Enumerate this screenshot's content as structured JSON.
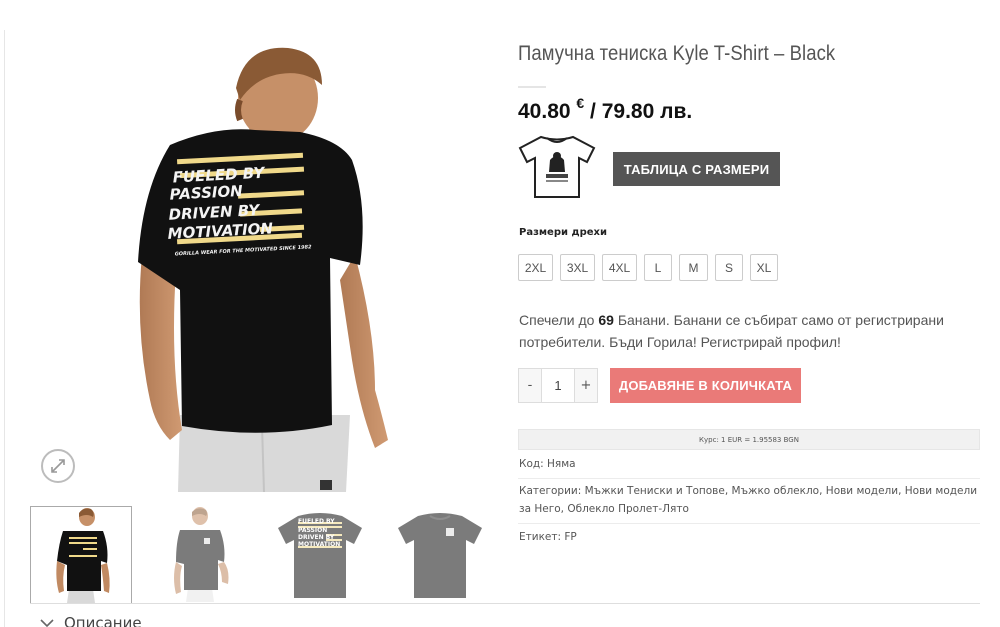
{
  "product": {
    "title": "Памучна тениска Kyle T-Shirt – Black",
    "price_eur": "40.80",
    "currency_eur": "€",
    "price_separator": "/",
    "price_bgn": "79.80 лв."
  },
  "size_chart_button": "ТАБЛИЦА С РАЗМЕРИ",
  "sizes_label": "Размери дрехи",
  "sizes": [
    "2XL",
    "3XL",
    "4XL",
    "L",
    "M",
    "S",
    "XL"
  ],
  "bananas": {
    "prefix": "Спечели до",
    "count": "69",
    "suffix": "Банани. Банани се събират само от регистрирани потребители. Бъди Горила! Регистрирай профил!"
  },
  "quantity": {
    "minus": "-",
    "value": "1",
    "plus": "+"
  },
  "add_to_cart": "ДОБАВЯНЕ В КОЛИЧКАТА",
  "exchange_rate": "Курс: 1 EUR = 1.95583 BGN",
  "meta": {
    "sku_label": "Код:",
    "sku_value": "Няма",
    "categories_label": "Категории:",
    "categories": [
      "Мъжки Тениски и Топове",
      "Мъжко облекло",
      "Нови модели",
      "Нови модели за Него",
      "Облекло Пролет-Лято"
    ],
    "tags_label": "Етикет:",
    "tags_value": "FP"
  },
  "main_image": {
    "print_lines": [
      "FUELED BY",
      "PASSION",
      "DRIVEN BY",
      "MOTIVATION"
    ],
    "print_tagline": "GORILLA WEAR  FOR THE MOTIVATED  SINCE 1982"
  },
  "thumbnail_print_lines": [
    "FUELED BY",
    "PASSION",
    "DRIVEN BY",
    "MOTIVATION"
  ],
  "description_tab": "Описание",
  "colors": {
    "add_to_cart": "#ea7a78",
    "size_chart": "#555555",
    "shirt": "#111111"
  }
}
